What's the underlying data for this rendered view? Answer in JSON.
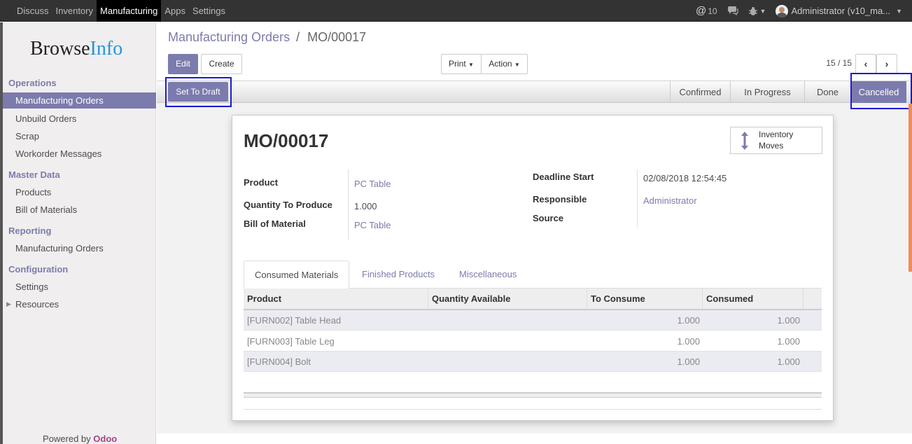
{
  "topbar": {
    "menu": [
      "Discuss",
      "Inventory",
      "Manufacturing",
      "Apps",
      "Settings"
    ],
    "active": "Manufacturing",
    "mentions": "10",
    "user": "Administrator (v10_ma..."
  },
  "sidebar": {
    "logo_browse": "Browse",
    "logo_info": "Info",
    "sections": {
      "operations": "Operations",
      "master_data": "Master Data",
      "reporting": "Reporting",
      "configuration": "Configuration"
    },
    "items": {
      "mo": "Manufacturing Orders",
      "unbuild": "Unbuild Orders",
      "scrap": "Scrap",
      "workorder_messages": "Workorder Messages",
      "products": "Products",
      "bom": "Bill of Materials",
      "reporting_mo": "Manufacturing Orders",
      "settings": "Settings",
      "resources": "Resources"
    },
    "powered_by": "Powered by",
    "odoo": "Odoo"
  },
  "breadcrumb": {
    "parent": "Manufacturing Orders",
    "sep": "/",
    "current": "MO/00017"
  },
  "buttons": {
    "edit": "Edit",
    "create": "Create",
    "print": "Print",
    "action": "Action",
    "set_to_draft": "Set To Draft"
  },
  "pager": "15 / 15",
  "stages": [
    "Confirmed",
    "In Progress",
    "Done",
    "Cancelled"
  ],
  "active_stage": "Cancelled",
  "record": {
    "title": "MO/00017",
    "stat_button": {
      "line1": "Inventory",
      "line2": "Moves"
    },
    "fields": {
      "product_label": "Product",
      "product_value": "PC Table",
      "qty_label": "Quantity To Produce",
      "qty_value": "1.000",
      "bom_label": "Bill of Material",
      "bom_value": "PC Table",
      "deadline_label": "Deadline Start",
      "deadline_value": "02/08/2018 12:54:45",
      "responsible_label": "Responsible",
      "responsible_value": "Administrator",
      "source_label": "Source"
    }
  },
  "tabs": [
    "Consumed Materials",
    "Finished Products",
    "Miscellaneous"
  ],
  "table": {
    "headers": [
      "Product",
      "Quantity Available",
      "To Consume",
      "Consumed"
    ],
    "rows": [
      {
        "product": "[FURN002] Table Head",
        "available": "",
        "to_consume": "1.000",
        "consumed": "1.000"
      },
      {
        "product": "[FURN003] Table Leg",
        "available": "",
        "to_consume": "1.000",
        "consumed": "1.000"
      },
      {
        "product": "[FURN004] Bolt",
        "available": "",
        "to_consume": "1.000",
        "consumed": "1.000"
      }
    ]
  },
  "colors": {
    "accent": "#7c7bad",
    "highlight": "#1a1adb",
    "odoo": "#a24689",
    "browseinfo_blue": "#2497d8"
  }
}
